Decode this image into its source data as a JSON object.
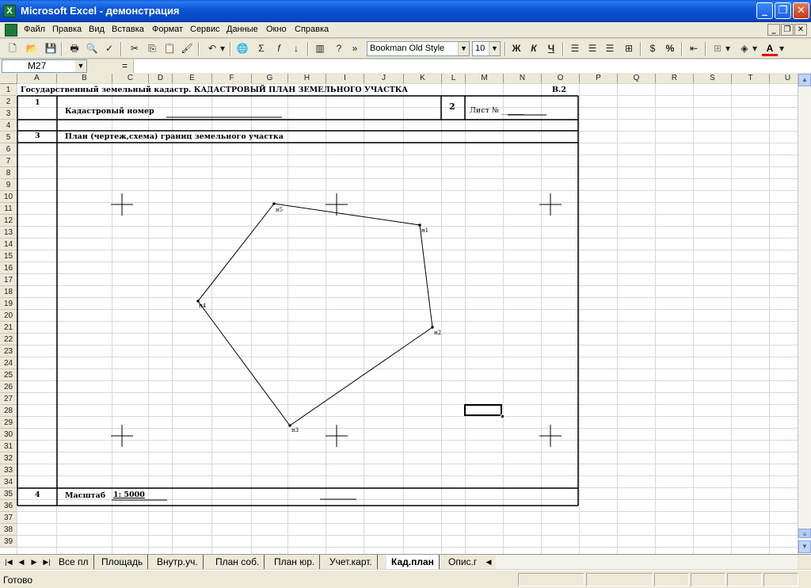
{
  "window": {
    "title": "Microsoft Excel - демонстрация",
    "app_icon": "excel-icon"
  },
  "menu": {
    "items": [
      "Файл",
      "Правка",
      "Вид",
      "Вставка",
      "Формат",
      "Сервис",
      "Данные",
      "Окно",
      "Справка"
    ]
  },
  "toolbar": {
    "font_name": "Bookman Old Style",
    "font_size": "10",
    "bold_label": "Ж",
    "italic_label": "К",
    "underline_label": "Ч"
  },
  "formula_bar": {
    "name_box": "M27",
    "equals": "=",
    "content": ""
  },
  "columns": [
    "A",
    "B",
    "C",
    "D",
    "E",
    "F",
    "G",
    "H",
    "I",
    "J",
    "K",
    "L",
    "M",
    "N",
    "O",
    "P",
    "Q",
    "R",
    "S",
    "T",
    "U"
  ],
  "rows": [
    "1",
    "2",
    "3",
    "4",
    "5",
    "6",
    "7",
    "8",
    "9",
    "10",
    "11",
    "12",
    "13",
    "14",
    "15",
    "16",
    "17",
    "18",
    "19",
    "20",
    "21",
    "22",
    "23",
    "24",
    "25",
    "26",
    "27",
    "28",
    "29",
    "30",
    "31",
    "32",
    "33",
    "34",
    "35",
    "36",
    "37",
    "38",
    "39"
  ],
  "sheet": {
    "title": "Государственный земельный кадастр. КАДАСТРОВЫЙ ПЛАН ЗЕМЕЛЬНОГО УЧАСТКА",
    "form_code": "В.2",
    "field1_num": "1",
    "field1_label": "Кадастровый номер",
    "field2_num": "2",
    "field2_label": "Лист № ______",
    "field3_num": "3",
    "field3_label": "План (чертеж,схема) границ земельного участка",
    "field4_num": "4",
    "field4_label": "Масштаб",
    "scale_value": "1: 5000",
    "points": [
      "н1",
      "н2",
      "н3",
      "н4",
      "н5"
    ]
  },
  "tabs": [
    "Все пл",
    "Площадь",
    "Внутр.уч.",
    "План соб.",
    "План юр.",
    "Учет.карт.",
    "Кад.план",
    "Опис.г"
  ],
  "active_tab": "Кад.план",
  "status": {
    "text": "Готово"
  }
}
